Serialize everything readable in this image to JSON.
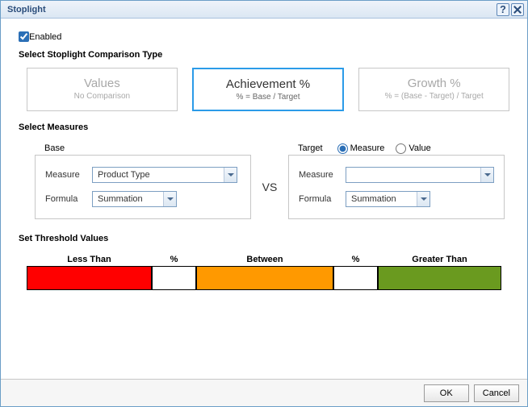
{
  "title": "Stoplight",
  "enabled": {
    "label": "Enabled",
    "checked": true
  },
  "section_type": "Select Stoplight Comparison Type",
  "types": [
    {
      "title": "Values",
      "subtitle": "No Comparison",
      "selected": false
    },
    {
      "title": "Achievement %",
      "subtitle": "% = Base / Target",
      "selected": true
    },
    {
      "title": "Growth %",
      "subtitle": "% = (Base - Target) / Target",
      "selected": false
    }
  ],
  "section_measures": "Select Measures",
  "base": {
    "title": "Base",
    "measure_label": "Measure",
    "measure_value": "Product Type",
    "formula_label": "Formula",
    "formula_value": "Summation"
  },
  "vs": "VS",
  "target": {
    "title": "Target",
    "radio_measure": "Measure",
    "radio_value": "Value",
    "radio_selected": "Measure",
    "measure_label": "Measure",
    "measure_value": "",
    "formula_label": "Formula",
    "formula_value": "Summation"
  },
  "section_threshold": "Set Threshold Values",
  "threshold": {
    "less_label": "Less Than",
    "pct_label": "%",
    "between_label": "Between",
    "greater_label": "Greater Than",
    "pct1": "",
    "pct2": "",
    "colors": {
      "low": "#ff0000",
      "mid": "#ff9900",
      "high": "#6a9a1f"
    }
  },
  "buttons": {
    "ok": "OK",
    "cancel": "Cancel"
  }
}
